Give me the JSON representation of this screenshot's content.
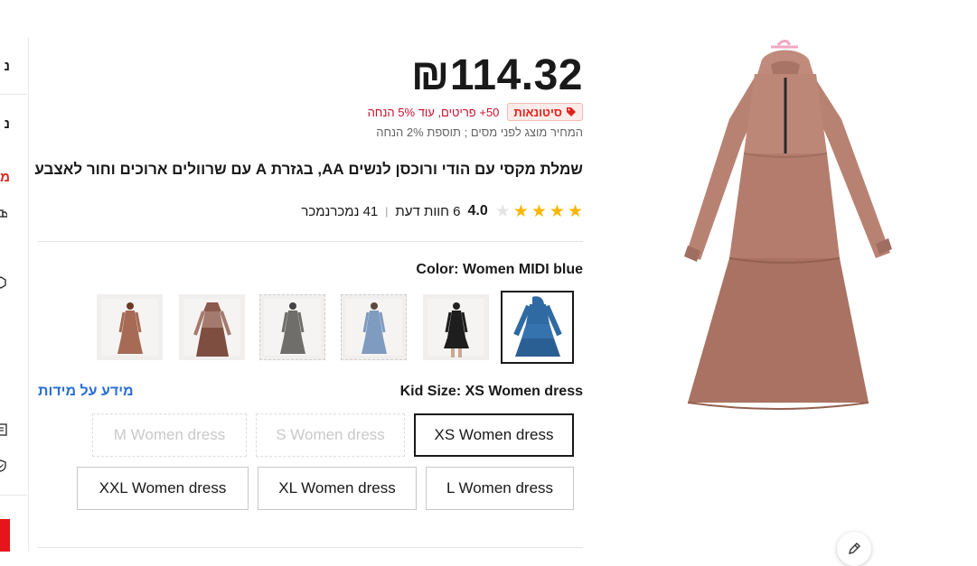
{
  "sidebar": {
    "items": [
      "נ",
      "נ",
      "מ"
    ]
  },
  "product": {
    "price": "₪114.32",
    "promo_badge": "סיטונאות",
    "promo_badge_icon": "tag-icon",
    "promo_text": "50+ פריטים, עוד 5% הנחה",
    "tax_note": "המחיר מוצג לפני מסים ; תוספת 2% הנחה",
    "title": "שמלת מקסי עם הודי ורוכסן לנשים AA, בגזרת A עם שרוולים ארוכים וחור לאצבע",
    "rating": 4.0,
    "rating_text": "4.0",
    "reviews": "6 חוות דעת",
    "sold": "41 נמכרנמכר",
    "stars_filled": 4,
    "stars_total": 5
  },
  "color": {
    "label": "Color: Women MIDI blue",
    "swatches": [
      {
        "name": "brown",
        "color": "#a66a55"
      },
      {
        "name": "brown-tiered",
        "color": "#8c5a4c"
      },
      {
        "name": "gray",
        "color": "#6f6e6a"
      },
      {
        "name": "light-blue",
        "color": "#7f9bc0"
      },
      {
        "name": "black",
        "color": "#1e1e1e"
      },
      {
        "name": "blue-selected",
        "color": "#2f6aa2"
      }
    ]
  },
  "size": {
    "label": "Kid Size: XS Women dress",
    "guide": "מידע על מידות",
    "options": [
      {
        "label": "XS Women dress",
        "state": "selected"
      },
      {
        "label": "S Women dress",
        "state": "disabled"
      },
      {
        "label": "M Women dress",
        "state": "disabled"
      },
      {
        "label": "L Women dress",
        "state": "normal"
      },
      {
        "label": "XL Women dress",
        "state": "normal"
      },
      {
        "label": "XXL Women dress",
        "state": "normal"
      }
    ]
  },
  "colors": {
    "accent_red": "#e2231a",
    "link_blue": "#2a6ed6",
    "star_gold": "#fbb600",
    "dress_main": "#b88273"
  },
  "image": {
    "edit_icon": "pencil-icon"
  }
}
